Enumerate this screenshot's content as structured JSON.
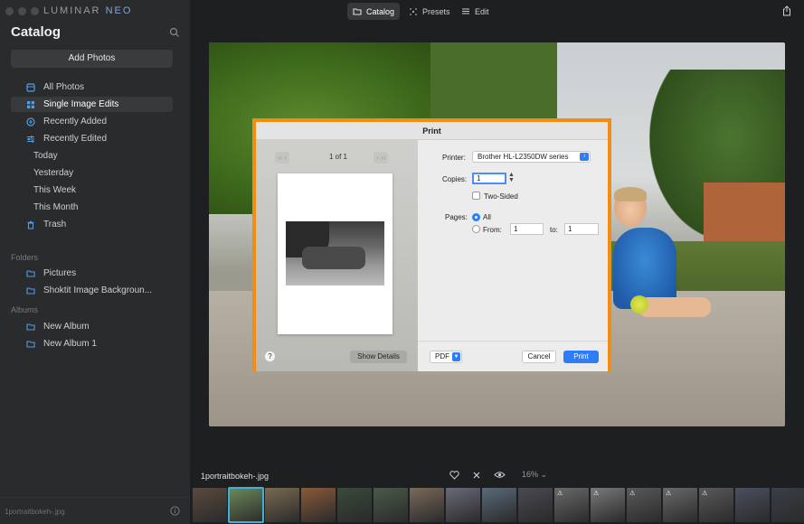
{
  "app": {
    "brand_main": "LUMINAR",
    "brand_accent": "NEO"
  },
  "sidebar": {
    "title": "Catalog",
    "add_photos": "Add Photos",
    "items": [
      {
        "label": "All Photos",
        "icon": "photos-icon"
      },
      {
        "label": "Single Image Edits",
        "icon": "grid-icon",
        "active": true
      },
      {
        "label": "Recently Added",
        "icon": "plus-circle-icon"
      },
      {
        "label": "Recently Edited",
        "icon": "sliders-icon"
      }
    ],
    "sub_items": [
      "Today",
      "Yesterday",
      "This Week",
      "This Month"
    ],
    "trash": "Trash",
    "folders_label": "Folders",
    "folders": [
      "Pictures",
      "Shoktit Image Backgroun..."
    ],
    "albums_label": "Albums",
    "albums": [
      "New Album",
      "New Album 1"
    ],
    "footer_filename": "1portraitbokeh-.jpg"
  },
  "toolbar": {
    "tabs": [
      {
        "label": "Catalog",
        "active": true
      },
      {
        "label": "Presets"
      },
      {
        "label": "Edit"
      }
    ]
  },
  "print_dialog": {
    "title": "Print",
    "page_count": "1 of 1",
    "printer_label": "Printer:",
    "printer_value": "Brother HL-L2350DW series",
    "copies_label": "Copies:",
    "copies_value": "1",
    "two_sided_label": "Two-Sided",
    "pages_label": "Pages:",
    "pages_all": "All",
    "pages_from_label": "From:",
    "pages_from_value": "1",
    "pages_to_label": "to:",
    "pages_to_value": "1",
    "help_label": "?",
    "show_details": "Show Details",
    "pdf_label": "PDF",
    "cancel": "Cancel",
    "print": "Print",
    "highlight_color": "#f28c12",
    "accent_color": "#2f7df6"
  },
  "filmstrip": {
    "current_file": "1portraitbokeh-.jpg",
    "zoom": "16%",
    "thumbnails": [
      {
        "color": "#5a4a3e"
      },
      {
        "color": "#6d8a5a",
        "selected": true
      },
      {
        "color": "#7a6a52"
      },
      {
        "color": "#8a5a3a"
      },
      {
        "color": "#3a4a3a"
      },
      {
        "color": "#4a5a4a"
      },
      {
        "color": "#7a6a5a"
      },
      {
        "color": "#6a6a7a"
      },
      {
        "color": "#5a6a7a"
      },
      {
        "color": "#4a4a52"
      },
      {
        "color": "#6a6a6a",
        "warning": true
      },
      {
        "color": "#7a7a7a",
        "warning": true
      },
      {
        "color": "#5a5a5a",
        "warning": true
      },
      {
        "color": "#6a6a6a",
        "warning": true
      },
      {
        "color": "#5a5a5a",
        "warning": true
      },
      {
        "color": "#4a5060"
      },
      {
        "color": "#3a3f48"
      }
    ]
  }
}
